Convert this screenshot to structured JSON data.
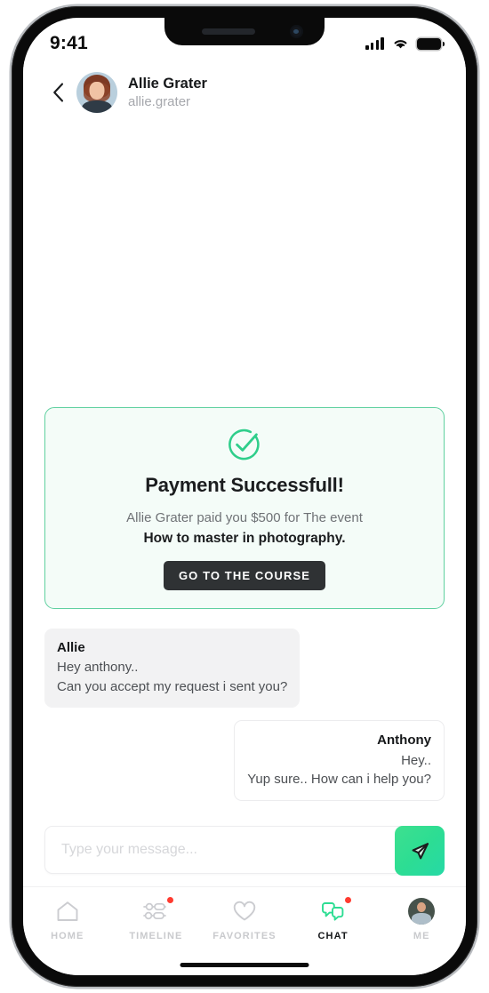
{
  "status_bar": {
    "time": "9:41",
    "signal_icon": "cellular-signal-icon",
    "wifi_icon": "wifi-icon",
    "battery_icon": "battery-full-icon"
  },
  "header": {
    "back_icon": "chevron-left-icon",
    "avatar_icon": "contact-avatar",
    "name": "Allie Grater",
    "handle": "allie.grater"
  },
  "payment_card": {
    "check_icon": "check-circle-icon",
    "title": "Payment Successfull!",
    "line1": "Allie Grater paid you $500 for The event",
    "line2": "How to master in photography.",
    "button_label": "GO TO THE  COURSE",
    "accent_color": "#5fd0a0",
    "background_color": "#f4fcf8",
    "button_color": "#2f3234"
  },
  "messages": [
    {
      "side": "left",
      "sender": "Allie",
      "lines": [
        "Hey anthony..",
        "Can you accept my request i sent you?"
      ]
    },
    {
      "side": "right",
      "sender": "Anthony",
      "lines": [
        "Hey..",
        "Yup sure.. How can i help you?"
      ]
    }
  ],
  "composer": {
    "placeholder": "Type your message...",
    "value": "",
    "send_icon": "send-paper-plane-icon",
    "send_color": "#2ddd93"
  },
  "tabbar": {
    "items": [
      {
        "label": "HOME",
        "icon": "home-icon",
        "active": false,
        "badge": false
      },
      {
        "label": "TIMELINE",
        "icon": "sliders-icon",
        "active": false,
        "badge": true
      },
      {
        "label": "FAVORITES",
        "icon": "heart-icon",
        "active": false,
        "badge": false
      },
      {
        "label": "CHAT",
        "icon": "chat-bubbles-icon",
        "active": true,
        "badge": true
      },
      {
        "label": "ME",
        "icon": "profile-avatar-icon",
        "active": false,
        "badge": false
      }
    ],
    "active_color": "#2ddd93",
    "badge_color": "#ff3b30"
  }
}
